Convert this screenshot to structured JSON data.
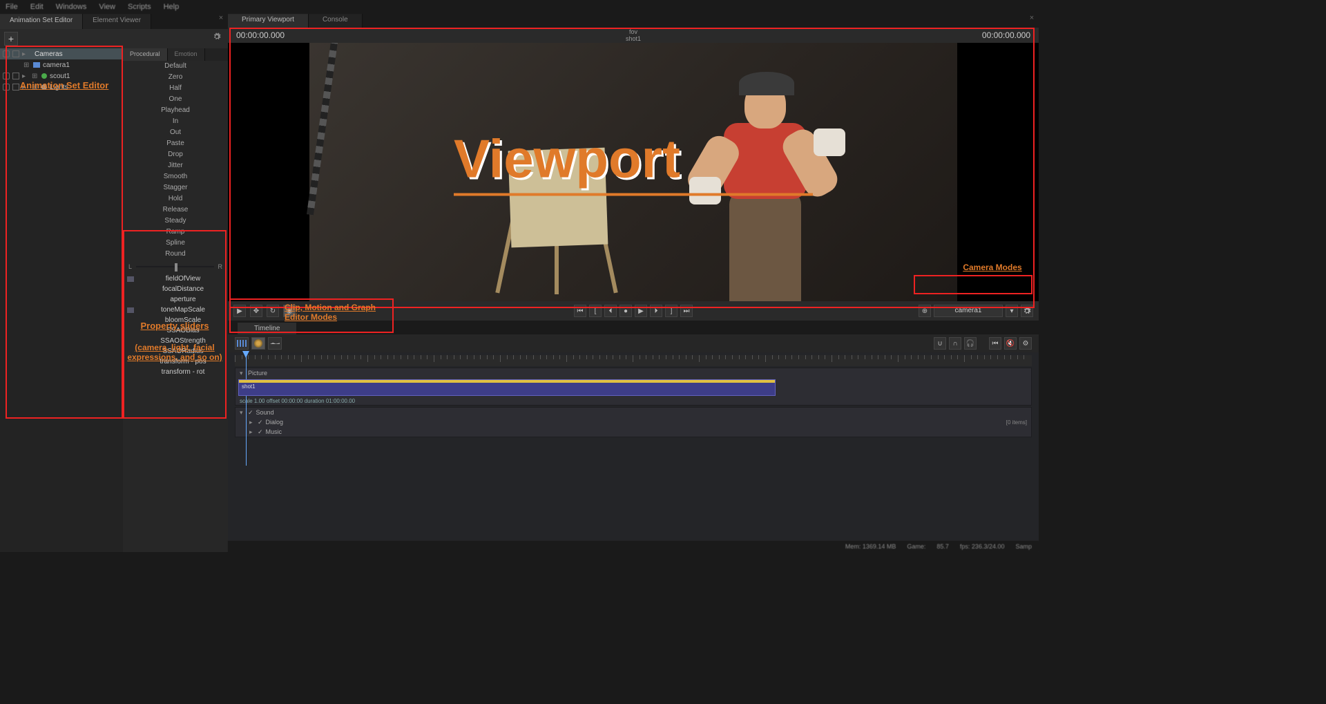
{
  "menu": [
    "File",
    "Edit",
    "Windows",
    "View",
    "Scripts",
    "Help"
  ],
  "left_tabs": {
    "active": "Animation Set Editor",
    "inactive": "Element Viewer"
  },
  "tree": {
    "items": [
      {
        "label": "Cameras",
        "type": "group",
        "selected": true,
        "depth": 0
      },
      {
        "label": "camera1",
        "type": "camera",
        "depth": 1
      },
      {
        "label": "scout1",
        "type": "model",
        "depth": 0
      },
      {
        "label": "Lights",
        "type": "light",
        "depth": 0
      }
    ]
  },
  "presets": {
    "tabs": {
      "active": "Procedural",
      "inactive": "Emotion"
    },
    "items": [
      "Default",
      "Zero",
      "Half",
      "One",
      "Playhead",
      "In",
      "Out",
      "Paste",
      "Drop",
      "Jitter",
      "Smooth",
      "Stagger",
      "Hold",
      "Release",
      "Steady",
      "Ramp",
      "Spline",
      "Round"
    ],
    "lr": {
      "left": "L",
      "right": "R"
    }
  },
  "properties": {
    "items": [
      {
        "label": "fieldOfView",
        "filled": true
      },
      {
        "label": "focalDistance",
        "filled": false
      },
      {
        "label": "aperture",
        "filled": false
      },
      {
        "label": "toneMapScale",
        "filled": true
      },
      {
        "label": "bloomScale",
        "filled": false
      },
      {
        "label": "SSAOBias",
        "filled": false
      },
      {
        "label": "SSAOStrength",
        "filled": false
      },
      {
        "label": "SSAORadius",
        "filled": false
      },
      {
        "label": "transform - pos",
        "filled": false
      },
      {
        "label": "transform - rot",
        "filled": false
      }
    ]
  },
  "right_tabs": {
    "active": "Primary Viewport",
    "inactive": "Console"
  },
  "viewport": {
    "tc_left": "00:00:00.000",
    "tc_right": "00:00:00.000",
    "top_label1": "fov",
    "top_label2": "shot1",
    "overlay": "Viewport",
    "camera_selected": "camera1"
  },
  "timeline": {
    "tab": "Timeline",
    "tracks": {
      "picture": {
        "name": "Picture",
        "shot_label": "shot1",
        "info": "scale 1.00  offset  00:00:00  duration  01:00:00.00"
      },
      "sound": {
        "name": "Sound",
        "sub1": {
          "name": "Dialog",
          "right": "[0 items]"
        },
        "sub2": {
          "name": "Music"
        }
      }
    }
  },
  "status": {
    "mem": "Mem: 1369.14 MB",
    "game": "Game:",
    "fps": "85.7",
    "fps2": "fps:  236.3/24.00",
    "sample": "Samp"
  },
  "annotations": {
    "anim_editor": "Animation Set Editor",
    "props1": "Property sliders",
    "props2": "(camera, light, facial expressions, and so on)",
    "modes": "Clip, Motion and Graph Editor Modes",
    "cammodes": "Camera Modes"
  }
}
